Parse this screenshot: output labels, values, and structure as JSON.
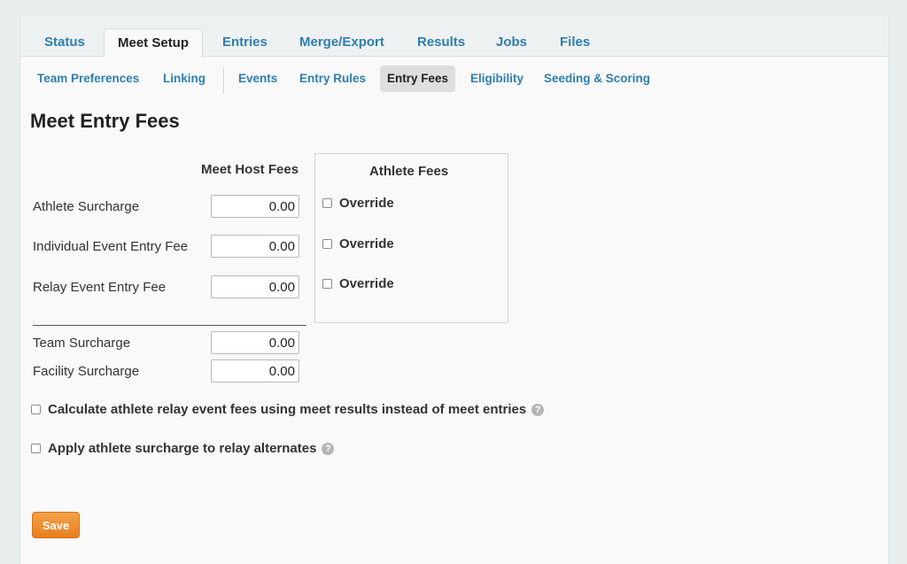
{
  "tabs": [
    {
      "label": "Status"
    },
    {
      "label": "Meet Setup"
    },
    {
      "label": "Entries"
    },
    {
      "label": "Merge/Export"
    },
    {
      "label": "Results"
    },
    {
      "label": "Jobs"
    },
    {
      "label": "Files"
    }
  ],
  "subnav": [
    {
      "label": "Team Preferences"
    },
    {
      "label": "Linking"
    },
    {
      "label": "Events"
    },
    {
      "label": "Entry Rules"
    },
    {
      "label": "Entry Fees"
    },
    {
      "label": "Eligibility"
    },
    {
      "label": "Seeding & Scoring"
    }
  ],
  "page_title": "Meet Entry Fees",
  "meet_host_fees": {
    "heading": "Meet Host Fees",
    "rows": [
      {
        "label": "Athlete Surcharge",
        "value": "0.00"
      },
      {
        "label": "Individual Event Entry Fee",
        "value": "0.00"
      },
      {
        "label": "Relay Event Entry Fee",
        "value": "0.00"
      },
      {
        "label": "Team Surcharge",
        "value": "0.00"
      },
      {
        "label": "Facility Surcharge",
        "value": "0.00"
      }
    ]
  },
  "athlete_fees": {
    "heading": "Athlete Fees",
    "override_label": "Override",
    "overrides": [
      false,
      false,
      false
    ]
  },
  "options": [
    {
      "label": "Calculate athlete relay event fees using meet results instead of meet entries",
      "checked": false
    },
    {
      "label": "Apply athlete surcharge to relay alternates",
      "checked": false
    }
  ],
  "help_glyph": "?",
  "save_label": "Save",
  "colors": {
    "link": "#2e7fb0",
    "save": "#e88a2a"
  }
}
